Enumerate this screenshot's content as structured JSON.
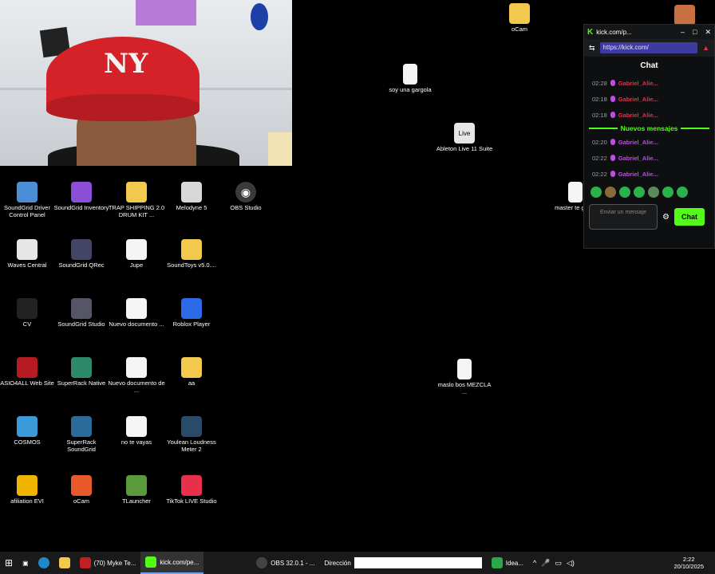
{
  "desktop": {
    "icons_col1": [
      {
        "label": "SoundGrid Driver Control Panel",
        "color": "#4a8fd6"
      },
      {
        "label": "Waves Central",
        "color": "#e6e6e6"
      },
      {
        "label": "CV",
        "color": "#222"
      },
      {
        "label": "ASIO4ALL Web Site",
        "color": "#b51c22"
      },
      {
        "label": "COSMOS",
        "color": "#3a9bd8"
      },
      {
        "label": "afiliation EVI",
        "color": "#f0b400"
      }
    ],
    "icons_col2": [
      {
        "label": "SoundGrid Inventory",
        "color": "#8a4fd6"
      },
      {
        "label": "SoundGrid QRec",
        "color": "#446"
      },
      {
        "label": "SoundGrid Studio",
        "color": "#556"
      },
      {
        "label": "SuperRack Native",
        "color": "#2c8a6a"
      },
      {
        "label": "SuperRack SoundGrid",
        "color": "#2c6a9a"
      },
      {
        "label": "oCam",
        "color": "#e85a2c"
      }
    ],
    "icons_col3": [
      {
        "label": "TRAP SHIPPING 2.0 DRUM KIT ...",
        "color": "#f2c94c"
      },
      {
        "label": "Jupe",
        "color": "#f5f5f5"
      },
      {
        "label": "Nuevo documento ...",
        "color": "#f5f5f5"
      },
      {
        "label": "Nuevo documento de ...",
        "color": "#f5f5f5"
      },
      {
        "label": "no te vayas",
        "color": "#f5f5f5"
      },
      {
        "label": "TLauncher",
        "color": "#5a9a3a"
      }
    ],
    "icons_col4": [
      {
        "label": "Melodyne 5",
        "color": "#d8d8d8"
      },
      {
        "label": "SoundToys v5.0....",
        "color": "#f2c94c"
      },
      {
        "label": "Roblox Player",
        "color": "#2c6ae8"
      },
      {
        "label": "aa",
        "color": "#f2c94c"
      },
      {
        "label": "Youlean Loudness Meter 2",
        "color": "#2a4a6a"
      },
      {
        "label": "TikTok LIVE Studio",
        "color": "#e8304a"
      }
    ],
    "obs_icon": {
      "label": "OBS Studio",
      "color": "#3a3a3a"
    },
    "scattered": [
      {
        "label": "oCam",
        "color": "#f2c94c"
      },
      {
        "label": "soy una gargola",
        "color": "#f5f5f5"
      },
      {
        "label": "Ableton Live 11 Suite",
        "color": "#e6e6e6"
      },
      {
        "label": "master te gabio",
        "color": "#f5f5f5"
      },
      {
        "label": "maslo bos MEZCLA ...",
        "color": "#f5f5f5"
      }
    ]
  },
  "popup": {
    "tab_title": "kick.com/p...",
    "url": "https://kick.com/",
    "chat_title": "Chat",
    "messages_old": [
      {
        "time": "02:28",
        "user": "Gabriel_Alie..."
      },
      {
        "time": "02:18",
        "user": "Gabriel_Alie..."
      },
      {
        "time": "02:18",
        "user": "Gabriel_Alie..."
      }
    ],
    "new_messages_label": "Nuevos mensajes",
    "messages_new": [
      {
        "time": "02:20",
        "user": "Gabriel_Alie..."
      },
      {
        "time": "02:22",
        "user": "Gabriel_Alie..."
      },
      {
        "time": "02:22",
        "user": "Gabriel_Alie..."
      }
    ],
    "input_placeholder": "Enviar un mensaje",
    "chat_button": "Chat",
    "old_user_color": "#e8304a",
    "new_user_color": "#c14ae8"
  },
  "taskbar": {
    "buttons": [
      {
        "label": "(70) Myke Te...",
        "color": "#c02020"
      },
      {
        "label": "kick.com/pe...",
        "color": "#53fc18"
      },
      {
        "label": "OBS 32.0.1 - ...",
        "color": "#444"
      }
    ],
    "address_label": "Dirección",
    "address_value": "",
    "ideas_label": "Idea...",
    "time": "2:22",
    "date": "20/10/2025"
  }
}
